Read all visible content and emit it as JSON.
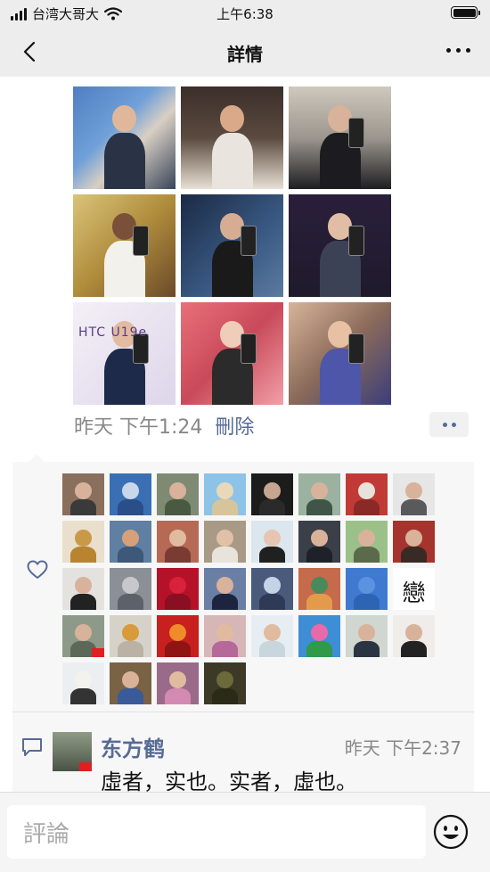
{
  "status_bar": {
    "carrier": "台湾大哥大",
    "time": "上午6:38",
    "icons": [
      "signal-icon",
      "wifi-icon",
      "battery-icon"
    ]
  },
  "nav": {
    "title": "詳情",
    "back_icon": "chevron-left-icon",
    "more_icon": "more-horizontal-icon"
  },
  "post": {
    "photos": [
      {
        "bg": "linear-gradient(135deg,#4f7fc2 0%,#6fa0d8 40%,#d9cfc4 60%,#384458 100%)",
        "skin": "#e0b79a",
        "body": "#2a3346",
        "phone": false
      },
      {
        "bg": "linear-gradient(180deg,#3b2f2a 0%,#5b4a3f 50%,#e8e0d4 100%)",
        "skin": "#d9a989",
        "body": "#e9e5de",
        "phone": false
      },
      {
        "bg": "linear-gradient(180deg,#cfc8bd 0%,#9c968e 50%,#1e1e22 100%)",
        "skin": "#d8b29a",
        "body": "#1c1c20",
        "phone": true
      },
      {
        "bg": "linear-gradient(135deg,#d9c47a 0%,#b08c3c 50%,#6a4a2a 100%)",
        "skin": "#7a5038",
        "body": "#f3f1ec",
        "phone": true
      },
      {
        "bg": "linear-gradient(135deg,#1b2a44 0%,#3a5a84 60%,#5d7aa0 100%)",
        "skin": "#d6ad92",
        "body": "#1a1a1a",
        "phone": true
      },
      {
        "bg": "linear-gradient(180deg,#2a1f3b 0%,#1f1a2c 100%)",
        "skin": "#e2bda5",
        "body": "#3c4256",
        "phone": true
      },
      {
        "bg": "linear-gradient(135deg,#f4f0f6 0%,#ddd6ea 100%)",
        "skin": "#e2bba0",
        "body": "#1e2a4a",
        "phone": true,
        "caption": "HTC U19e"
      },
      {
        "bg": "linear-gradient(135deg,#e8707a 0%,#c94a5a 50%,#f2a0a8 100%)",
        "skin": "#f0cdb8",
        "body": "#2b2b2b",
        "phone": true
      },
      {
        "bg": "linear-gradient(135deg,#d7b59a 0%,#8b6a5a 50%,#3a3e7a 100%)",
        "skin": "#e8c0a4",
        "body": "#4d56a8",
        "phone": true
      }
    ],
    "time": "昨天 下午1:24",
    "delete_label": "刪除",
    "more_icon": "more-dots-icon"
  },
  "likes": {
    "icon": "heart-icon",
    "avatars": [
      {
        "bg": "#8a6f5d",
        "h": "#d8b29a",
        "b": "#3a3a3a"
      },
      {
        "bg": "#3b6fb4",
        "h": "#c9d7ea",
        "b": "#2a4f88"
      },
      {
        "bg": "#7e8a72",
        "h": "#d8b29a",
        "b": "#4a5a42"
      },
      {
        "bg": "#8ec3e8",
        "h": "#e9d9b8",
        "b": "#d8c49a"
      },
      {
        "bg": "#1c1c1c",
        "h": "#c8a590",
        "b": "#2a2a2a"
      },
      {
        "bg": "#9bb2a0",
        "h": "#d8b29a",
        "b": "#3f5548"
      },
      {
        "bg": "#c23a35",
        "h": "#e8e2da",
        "b": "#8a2a26"
      },
      {
        "bg": "#e6e6e6",
        "h": "#d8b29a",
        "b": "#5a5a5a"
      },
      {
        "bg": "#e9dfcc",
        "h": "#c89a48",
        "b": "#b88430"
      },
      {
        "bg": "#5f7fa3",
        "h": "#d8a078",
        "b": "#3d5878"
      },
      {
        "bg": "#b66a55",
        "h": "#e1bba0",
        "b": "#7a3b32"
      },
      {
        "bg": "#a89a84",
        "h": "#e0c0a6",
        "b": "#e8e4dc"
      },
      {
        "bg": "#dce6ee",
        "h": "#e6c6b2",
        "b": "#202020"
      },
      {
        "bg": "#3a3f48",
        "h": "#d8b29a",
        "b": "#1e2228"
      },
      {
        "bg": "#9cc08a",
        "h": "#d8b29a",
        "b": "#5a6a4a"
      },
      {
        "bg": "#a4342d",
        "h": "#d8b29a",
        "b": "#3a2a26"
      },
      {
        "bg": "#e4e2df",
        "h": "#d8b29a",
        "b": "#222"
      },
      {
        "bg": "#8b8f96",
        "h": "#c6c8cc",
        "b": "#5d626a"
      },
      {
        "bg": "#b5122a",
        "h": "#d8213a",
        "b": "#8a0f22"
      },
      {
        "bg": "#6b7fa4",
        "h": "#d8b29a",
        "b": "#1c2440"
      },
      {
        "bg": "#4a5a7a",
        "h": "#c6d2e6",
        "b": "#2e3a56"
      },
      {
        "bg": "#c56a4a",
        "h": "#4a8a5a",
        "b": "#e39b4b"
      },
      {
        "bg": "#3f7ad0",
        "h": "#5b93e0",
        "b": "#2e64b4"
      },
      {
        "bg": "#ffffff",
        "h": null,
        "b": null,
        "text": "戀"
      },
      {
        "bg": "#8d9a8a",
        "h": "#d8b29a",
        "b": "#5c6858",
        "flag": true
      },
      {
        "bg": "#d7d2c8",
        "h": "#d89a3a",
        "b": "#b9b2a5"
      },
      {
        "bg": "#c81f1f",
        "h": "#f08a2a",
        "b": "#8f1414"
      },
      {
        "bg": "#d6b6b6",
        "h": "#e1bba0",
        "b": "#b6689a"
      },
      {
        "bg": "#e7eef3",
        "h": "#e1bba0",
        "b": "#c9d6de"
      },
      {
        "bg": "#3e8ed6",
        "h": "#e86aa8",
        "b": "#2f9a4a"
      },
      {
        "bg": "#cfd7d0",
        "h": "#d8b29a",
        "b": "#2b3442"
      },
      {
        "bg": "#f0ecea",
        "h": "#d8b29a",
        "b": "#222"
      },
      {
        "bg": "#eceff2",
        "h": "#f4f2ee",
        "b": "#333"
      },
      {
        "bg": "#7a6244",
        "h": "#d8b29a",
        "b": "#3a5a9a"
      },
      {
        "bg": "#9a6a8a",
        "h": "#e1bba0",
        "b": "#d38ab0"
      },
      {
        "bg": "#3c3a26",
        "h": "#6a6a3a",
        "b": "#2a2a18"
      }
    ]
  },
  "comment": {
    "icon": "comment-icon",
    "name": "东方鹤",
    "time": "昨天 下午2:37",
    "text": "虛者，实也。实者，虛也。"
  },
  "input_bar": {
    "placeholder": "評論",
    "emoji_icon": "emoji-icon"
  }
}
